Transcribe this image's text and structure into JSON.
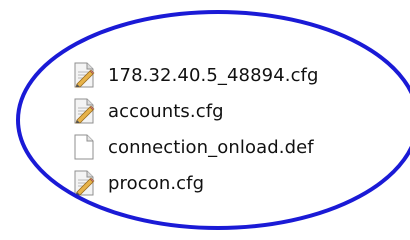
{
  "file_list": {
    "items": [
      {
        "name": "178.32.40.5_48894.cfg",
        "icon": "config-file-icon"
      },
      {
        "name": "accounts.cfg",
        "icon": "config-file-icon"
      },
      {
        "name": "connection_onload.def",
        "icon": "blank-file-icon"
      },
      {
        "name": "procon.cfg",
        "icon": "config-file-icon"
      }
    ]
  },
  "annotation": {
    "shape": "ellipse",
    "color": "#1a1ad6"
  }
}
